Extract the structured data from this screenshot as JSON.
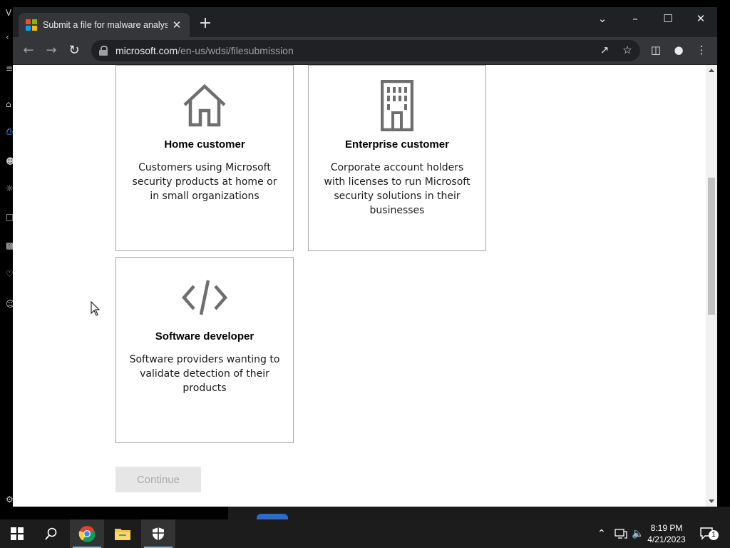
{
  "browser": {
    "tab_title": "Submit a file for malware analysis",
    "url_domain": "microsoft.com",
    "url_path": "/en-us/wdsi/filesubmission"
  },
  "page": {
    "cards": [
      {
        "title": "Home customer",
        "description": "Customers using Microsoft security products at home or in small organizations",
        "icon": "house-icon"
      },
      {
        "title": "Enterprise customer",
        "description": "Corporate account holders with licenses to run Microsoft security solutions in their businesses",
        "icon": "building-icon"
      },
      {
        "title": "Software developer",
        "description": "Software providers wanting to validate detection of their products",
        "icon": "code-icon"
      }
    ],
    "continue_label": "Continue"
  },
  "taskbar": {
    "time": "8:19 PM",
    "date": "4/21/2023",
    "notification_count": "1"
  },
  "colors": {
    "chrome_dark": "#202124",
    "chrome_toolbar": "#35363a",
    "card_border": "#a6a6a6",
    "icon_gray": "#6e6e6e",
    "button_disabled_bg": "#e6e6e6",
    "button_disabled_text": "#ababab"
  }
}
